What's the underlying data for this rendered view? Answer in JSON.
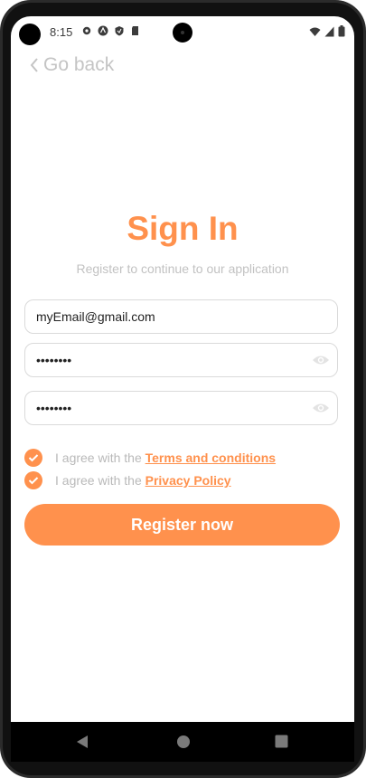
{
  "status_bar": {
    "time": "8:15",
    "icons_left": [
      "gear-icon",
      "android-icon",
      "shield-icon",
      "sd-card-icon"
    ],
    "icons_right": [
      "wifi-icon",
      "signal-icon",
      "battery-icon"
    ]
  },
  "nav": {
    "go_back_label": "Go back"
  },
  "header": {
    "title": "Sign In",
    "subtitle": "Register to continue to our application"
  },
  "form": {
    "email_value": "myEmail@gmail.com",
    "password_value": "••••••••",
    "confirm_password_value": "••••••••"
  },
  "agreements": [
    {
      "prefix": "I agree with the",
      "link": "Terms and conditions",
      "checked": true
    },
    {
      "prefix": "I agree with the",
      "link": "Privacy Policy",
      "checked": true
    }
  ],
  "actions": {
    "register_label": "Register now"
  },
  "colors": {
    "accent": "#ff914d",
    "muted": "#c2c2c2"
  },
  "system_nav": [
    "back-icon",
    "home-icon",
    "recents-icon"
  ]
}
